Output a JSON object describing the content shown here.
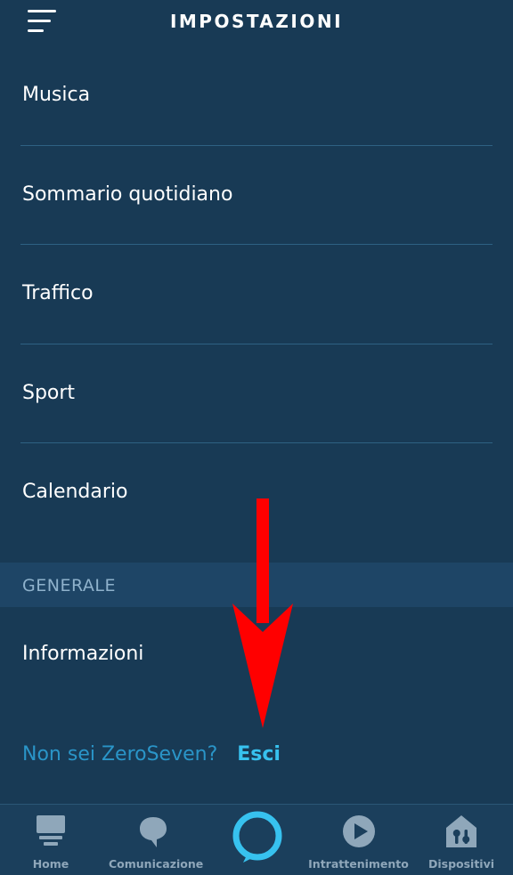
{
  "header": {
    "title": "IMPOSTAZIONI"
  },
  "settings_items": [
    {
      "label": "Musica"
    },
    {
      "label": "Sommario quotidiano"
    },
    {
      "label": "Traffico"
    },
    {
      "label": "Sport"
    },
    {
      "label": "Calendario"
    }
  ],
  "general_section": {
    "title": "GENERALE",
    "items": [
      {
        "label": "Informazioni"
      }
    ]
  },
  "account": {
    "question": "Non sei ZeroSeven?",
    "signout_label": "Esci"
  },
  "tabbar": {
    "tabs": [
      {
        "label": "Home",
        "icon": "home-icon"
      },
      {
        "label": "Comunicazione",
        "icon": "chat-bubble-icon"
      },
      {
        "label": "",
        "icon": "alexa-ring-icon"
      },
      {
        "label": "Intrattenimento",
        "icon": "play-icon"
      },
      {
        "label": "Dispositivi",
        "icon": "smart-home-icon"
      }
    ]
  },
  "colors": {
    "background": "#183a55",
    "section_header": "#1e4566",
    "accent": "#37c2ef",
    "annotation_arrow": "#ff0000"
  }
}
